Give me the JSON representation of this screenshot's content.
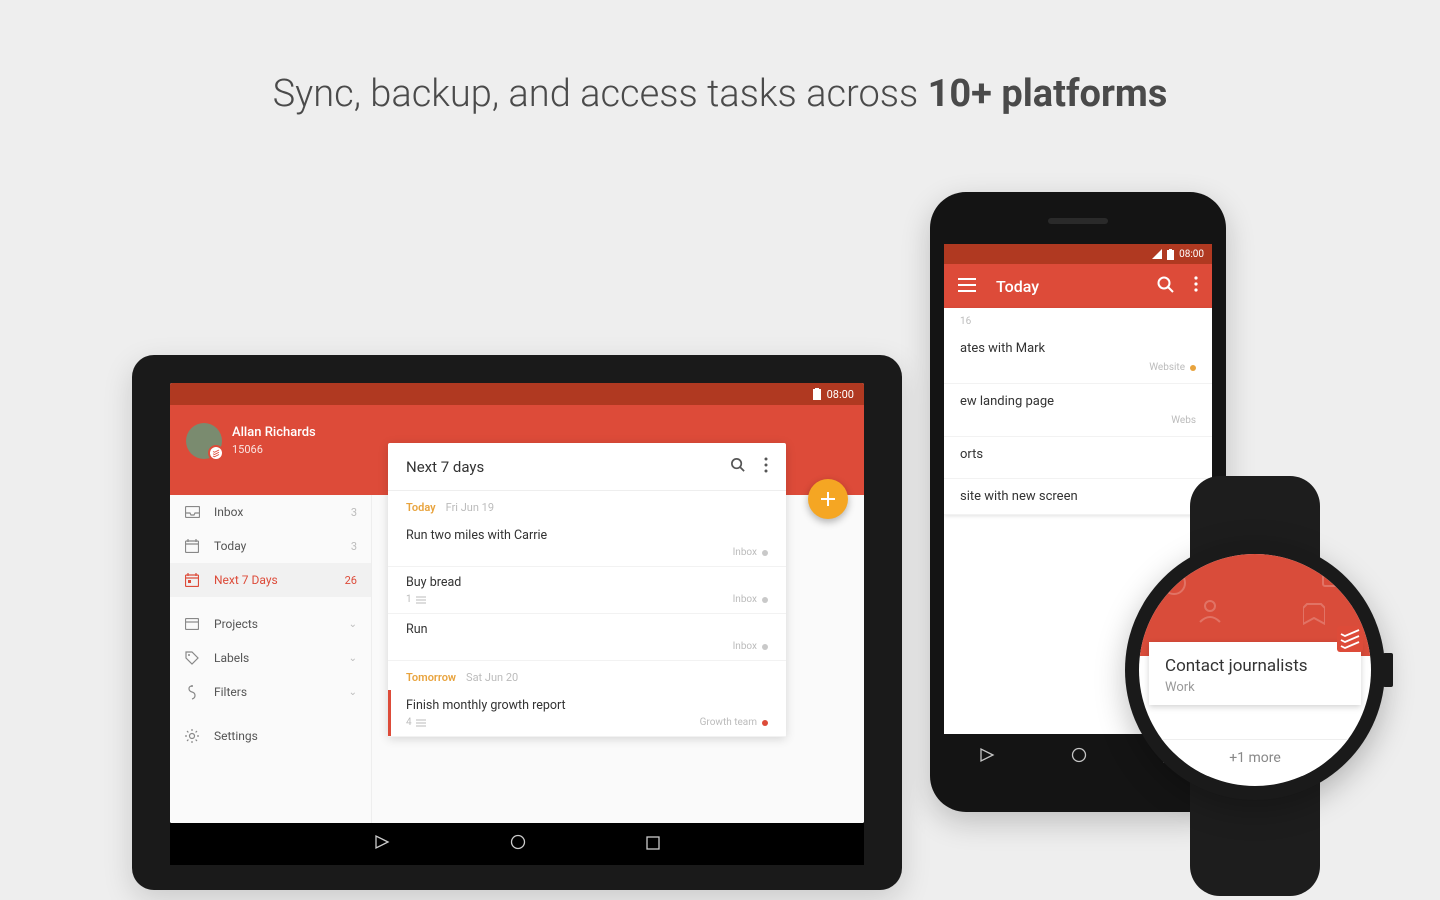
{
  "headline_prefix": "Sync, backup, and access tasks across ",
  "headline_strong": "10+ platforms",
  "clocks": {
    "tablet": "08:00",
    "phone": "08:00"
  },
  "tablet": {
    "user": {
      "name": "Allan Richards",
      "karma": "15066"
    },
    "sidebar": {
      "inbox": {
        "label": "Inbox",
        "count": "3"
      },
      "today": {
        "label": "Today",
        "count": "3"
      },
      "next7": {
        "label": "Next 7 Days",
        "count": "26"
      },
      "projects": {
        "label": "Projects"
      },
      "labels": {
        "label": "Labels"
      },
      "filters": {
        "label": "Filters"
      },
      "settings": {
        "label": "Settings"
      }
    },
    "card": {
      "title": "Next 7 days",
      "day1": {
        "name": "Today",
        "date": "Fri Jun 19"
      },
      "task1": {
        "title": "Run two miles with Carrie",
        "project": "Inbox"
      },
      "task2": {
        "title": "Buy bread",
        "sub": "1",
        "project": "Inbox"
      },
      "task3": {
        "title": "Run",
        "project": "Inbox"
      },
      "day2": {
        "name": "Tomorrow",
        "date": "Sat Jun 20"
      },
      "task4": {
        "title": "Finish monthly growth report",
        "sub": "4",
        "project": "Growth team"
      }
    }
  },
  "phone": {
    "title": "Today",
    "day": "16",
    "task1": {
      "title": "ates with Mark",
      "project": "Website"
    },
    "task2": {
      "title": "ew landing page",
      "project": "Webs"
    },
    "task3": {
      "title": "orts"
    },
    "task4": {
      "title": "site with new screen"
    }
  },
  "watch": {
    "task": "Contact journalists",
    "project": "Work",
    "more": "+1 more"
  }
}
